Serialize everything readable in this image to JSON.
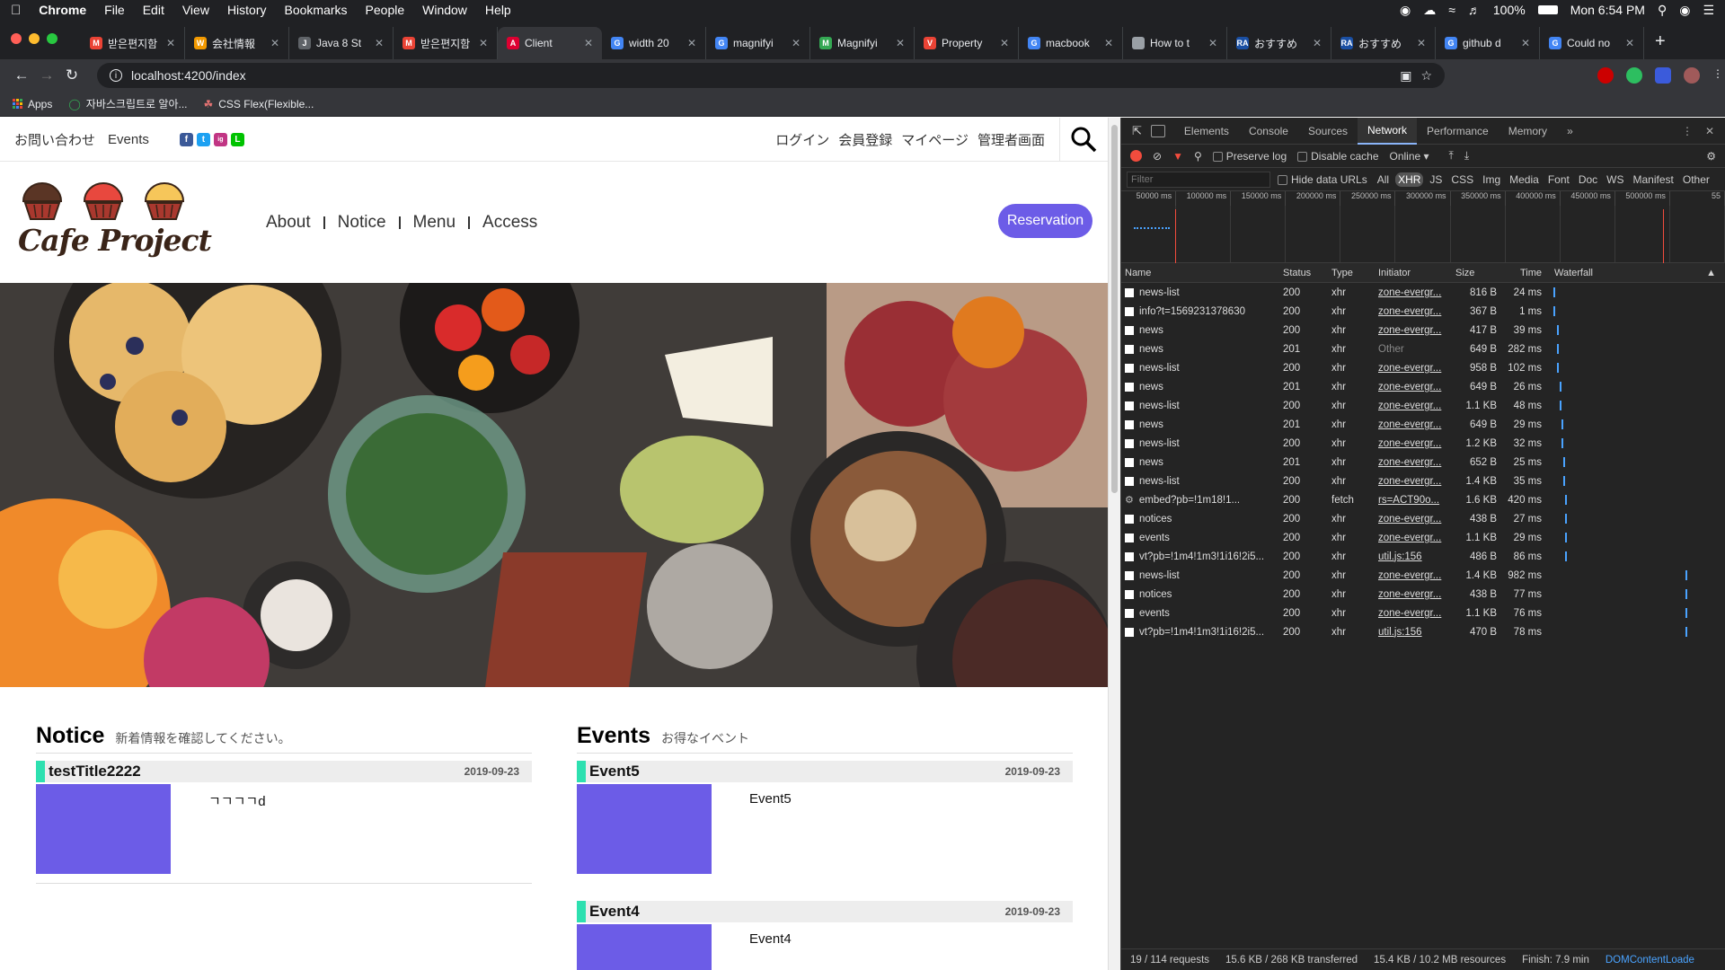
{
  "menubar": {
    "app": "Chrome",
    "menus": [
      "File",
      "Edit",
      "View",
      "History",
      "Bookmarks",
      "People",
      "Window",
      "Help"
    ],
    "battery": "100%",
    "clock": "Mon 6:54 PM"
  },
  "tabs": [
    {
      "title": "받은편지함",
      "fav_color": "#ea4335",
      "fav_text": "M"
    },
    {
      "title": "会社情報",
      "fav_color": "#f29900",
      "fav_text": "W"
    },
    {
      "title": "Java 8 St",
      "fav_color": "#5f6368",
      "fav_text": "J"
    },
    {
      "title": "받은편지함",
      "fav_color": "#ea4335",
      "fav_text": "M"
    },
    {
      "title": "Client",
      "fav_color": "#dd0031",
      "fav_text": "A",
      "active": true
    },
    {
      "title": "width 20",
      "fav_color": "#4285f4",
      "fav_text": "G"
    },
    {
      "title": "magnifyi",
      "fav_color": "#4285f4",
      "fav_text": "G"
    },
    {
      "title": "Magnifyi",
      "fav_color": "#34a853",
      "fav_text": "M"
    },
    {
      "title": "Property",
      "fav_color": "#ea4335",
      "fav_text": "V"
    },
    {
      "title": "macbook",
      "fav_color": "#4285f4",
      "fav_text": "G"
    },
    {
      "title": "How to t",
      "fav_color": "#9aa0a6",
      "fav_text": ""
    },
    {
      "title": "おすすめ",
      "fav_color": "#1a4fa3",
      "fav_text": "RA"
    },
    {
      "title": "おすすめ",
      "fav_color": "#1a4fa3",
      "fav_text": "RA"
    },
    {
      "title": "github d",
      "fav_color": "#4285f4",
      "fav_text": "G"
    },
    {
      "title": "Could no",
      "fav_color": "#4285f4",
      "fav_text": "G"
    }
  ],
  "toolbar": {
    "url": "localhost:4200/index"
  },
  "bookmarks": [
    "Apps",
    "자바스크립트로 알아...",
    "CSS Flex(Flexible..."
  ],
  "site": {
    "top_left": [
      "お問い合わせ",
      "Events"
    ],
    "social": [
      "f",
      "t",
      "ig",
      "L"
    ],
    "top_right": [
      "ログイン",
      "会員登録",
      "マイページ",
      "管理者画面"
    ],
    "logo": "Cafe Project",
    "nav": [
      "About",
      "Notice",
      "Menu",
      "Access"
    ],
    "reservation": "Reservation",
    "notice": {
      "title": "Notice",
      "subtitle": "新着情報を確認してください。",
      "items": [
        {
          "title": "testTitle2222",
          "date": "2019-09-23",
          "desc": "ㄱㄱㄱㄱd"
        }
      ]
    },
    "events": {
      "title": "Events",
      "subtitle": "お得なイベント",
      "items": [
        {
          "title": "Event5",
          "date": "2019-09-23",
          "desc": "Event5"
        },
        {
          "title": "Event4",
          "date": "2019-09-23",
          "desc": "Event4"
        }
      ]
    }
  },
  "devtools": {
    "tabs": [
      "Elements",
      "Console",
      "Sources",
      "Network",
      "Performance",
      "Memory"
    ],
    "active_tab": "Network",
    "preserve_log": "Preserve log",
    "disable_cache": "Disable cache",
    "throttle": "Online",
    "filter_placeholder": "Filter",
    "hide_data_urls": "Hide data URLs",
    "filter_types": [
      "All",
      "XHR",
      "JS",
      "CSS",
      "Img",
      "Media",
      "Font",
      "Doc",
      "WS",
      "Manifest",
      "Other"
    ],
    "overview_ticks": [
      "50000 ms",
      "100000 ms",
      "150000 ms",
      "200000 ms",
      "250000 ms",
      "300000 ms",
      "350000 ms",
      "400000 ms",
      "450000 ms",
      "500000 ms",
      "55"
    ],
    "columns": [
      "Name",
      "Status",
      "Type",
      "Initiator",
      "Size",
      "Time",
      "Waterfall"
    ],
    "rows": [
      {
        "name": "news-list",
        "status": "200",
        "type": "xhr",
        "initiator": "zone-evergr...",
        "size": "816 B",
        "time": "24 ms",
        "wf": 0.005
      },
      {
        "name": "info?t=1569231378630",
        "status": "200",
        "type": "xhr",
        "initiator": "zone-evergr...",
        "size": "367 B",
        "time": "1 ms",
        "wf": 0.005
      },
      {
        "name": "news",
        "status": "200",
        "type": "xhr",
        "initiator": "zone-evergr...",
        "size": "417 B",
        "time": "39 ms",
        "wf": 0.03
      },
      {
        "name": "news",
        "status": "201",
        "type": "xhr",
        "initiator": "Other",
        "size": "649 B",
        "time": "282 ms",
        "wf": 0.03
      },
      {
        "name": "news-list",
        "status": "200",
        "type": "xhr",
        "initiator": "zone-evergr...",
        "size": "958 B",
        "time": "102 ms",
        "wf": 0.035
      },
      {
        "name": "news",
        "status": "201",
        "type": "xhr",
        "initiator": "zone-evergr...",
        "size": "649 B",
        "time": "26 ms",
        "wf": 0.05
      },
      {
        "name": "news-list",
        "status": "200",
        "type": "xhr",
        "initiator": "zone-evergr...",
        "size": "1.1 KB",
        "time": "48 ms",
        "wf": 0.05
      },
      {
        "name": "news",
        "status": "201",
        "type": "xhr",
        "initiator": "zone-evergr...",
        "size": "649 B",
        "time": "29 ms",
        "wf": 0.065
      },
      {
        "name": "news-list",
        "status": "200",
        "type": "xhr",
        "initiator": "zone-evergr...",
        "size": "1.2 KB",
        "time": "32 ms",
        "wf": 0.065
      },
      {
        "name": "news",
        "status": "201",
        "type": "xhr",
        "initiator": "zone-evergr...",
        "size": "652 B",
        "time": "25 ms",
        "wf": 0.08
      },
      {
        "name": "news-list",
        "status": "200",
        "type": "xhr",
        "initiator": "zone-evergr...",
        "size": "1.4 KB",
        "time": "35 ms",
        "wf": 0.08
      },
      {
        "name": "embed?pb=!1m18!1...",
        "status": "200",
        "type": "fetch",
        "initiator": "rs=ACT90o...",
        "size": "1.6 KB",
        "time": "420 ms",
        "wf": 0.095,
        "gear": true
      },
      {
        "name": "notices",
        "status": "200",
        "type": "xhr",
        "initiator": "zone-evergr...",
        "size": "438 B",
        "time": "27 ms",
        "wf": 0.095
      },
      {
        "name": "events",
        "status": "200",
        "type": "xhr",
        "initiator": "zone-evergr...",
        "size": "1.1 KB",
        "time": "29 ms",
        "wf": 0.095
      },
      {
        "name": "vt?pb=!1m4!1m3!1i16!2i5...",
        "status": "200",
        "type": "xhr",
        "initiator": "util.js:156",
        "size": "486 B",
        "time": "86 ms",
        "wf": 0.095
      },
      {
        "name": "news-list",
        "status": "200",
        "type": "xhr",
        "initiator": "zone-evergr...",
        "size": "1.4 KB",
        "time": "982 ms",
        "wf": 0.985
      },
      {
        "name": "notices",
        "status": "200",
        "type": "xhr",
        "initiator": "zone-evergr...",
        "size": "438 B",
        "time": "77 ms",
        "wf": 0.985
      },
      {
        "name": "events",
        "status": "200",
        "type": "xhr",
        "initiator": "zone-evergr...",
        "size": "1.1 KB",
        "time": "76 ms",
        "wf": 0.985
      },
      {
        "name": "vt?pb=!1m4!1m3!1i16!2i5...",
        "status": "200",
        "type": "xhr",
        "initiator": "util.js:156",
        "size": "470 B",
        "time": "78 ms",
        "wf": 0.985
      }
    ],
    "status": {
      "requests": "19 / 114 requests",
      "transferred": "15.6 KB / 268 KB transferred",
      "resources": "15.4 KB / 10.2 MB resources",
      "finish": "Finish: 7.9 min",
      "dcl": "DOMContentLoade"
    }
  }
}
